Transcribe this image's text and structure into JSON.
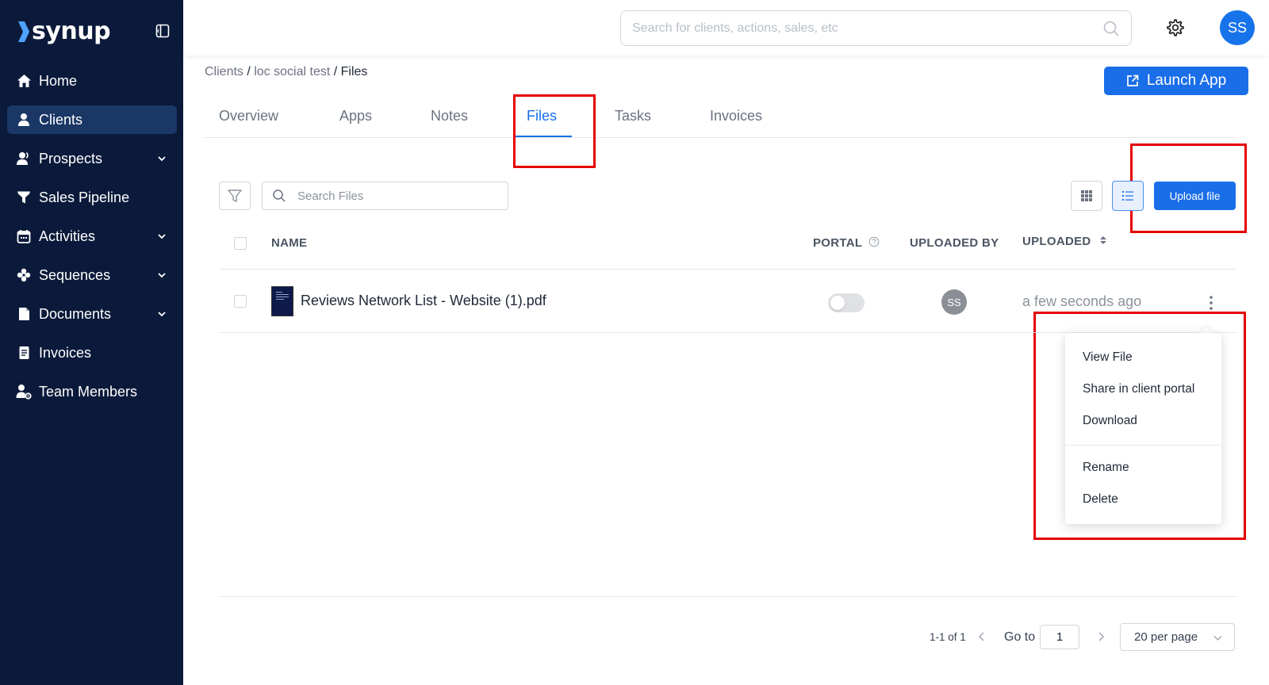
{
  "brand": {
    "name": "synup"
  },
  "sidebar": {
    "items": [
      {
        "label": "Home",
        "icon": "home-icon",
        "active": false,
        "has_submenu": false
      },
      {
        "label": "Clients",
        "icon": "user-icon",
        "active": true,
        "has_submenu": false
      },
      {
        "label": "Prospects",
        "icon": "users-icon",
        "active": false,
        "has_submenu": true
      },
      {
        "label": "Sales Pipeline",
        "icon": "funnel-icon",
        "active": false,
        "has_submenu": false
      },
      {
        "label": "Activities",
        "icon": "calendar-icon",
        "active": false,
        "has_submenu": true
      },
      {
        "label": "Sequences",
        "icon": "gear-flower-icon",
        "active": false,
        "has_submenu": true
      },
      {
        "label": "Documents",
        "icon": "document-icon",
        "active": false,
        "has_submenu": true
      },
      {
        "label": "Invoices",
        "icon": "receipt-icon",
        "active": false,
        "has_submenu": false
      },
      {
        "label": "Team Members",
        "icon": "team-settings-icon",
        "active": false,
        "has_submenu": false
      }
    ]
  },
  "header": {
    "search_placeholder": "Search for clients, actions, sales, etc",
    "avatar_initials": "SS"
  },
  "breadcrumb": {
    "items": [
      "Clients",
      "loc social test",
      "Files"
    ],
    "separator": " / "
  },
  "launch_button": {
    "label": "Launch App"
  },
  "tabs": [
    {
      "label": "Overview",
      "active": false
    },
    {
      "label": "Apps",
      "active": false
    },
    {
      "label": "Notes",
      "active": false
    },
    {
      "label": "Files",
      "active": true
    },
    {
      "label": "Tasks",
      "active": false
    },
    {
      "label": "Invoices",
      "active": false
    }
  ],
  "toolbar": {
    "search_placeholder": "Search Files",
    "upload_label": "Upload file",
    "view_mode": "list"
  },
  "table": {
    "columns": {
      "name": "NAME",
      "portal": "PORTAL",
      "uploaded_by": "UPLOADED BY",
      "uploaded": "UPLOADED"
    },
    "rows": [
      {
        "name": "Reviews Network List - Website (1).pdf",
        "portal_enabled": false,
        "uploaded_by": "SS",
        "uploaded": "a few seconds ago"
      }
    ]
  },
  "context_menu": {
    "items": [
      "View File",
      "Share in client portal",
      "Download"
    ],
    "items_secondary": [
      "Rename",
      "Delete"
    ]
  },
  "pagination": {
    "count_label": "1-1 of 1",
    "goto_label": "Go to",
    "current_page": "1",
    "page_size_label": "20 per page"
  },
  "colors": {
    "sidebar_bg": "#0b1a3a",
    "sidebar_active": "#1b3766",
    "primary": "#1a6ee8",
    "annotation_red": "#e60000"
  }
}
